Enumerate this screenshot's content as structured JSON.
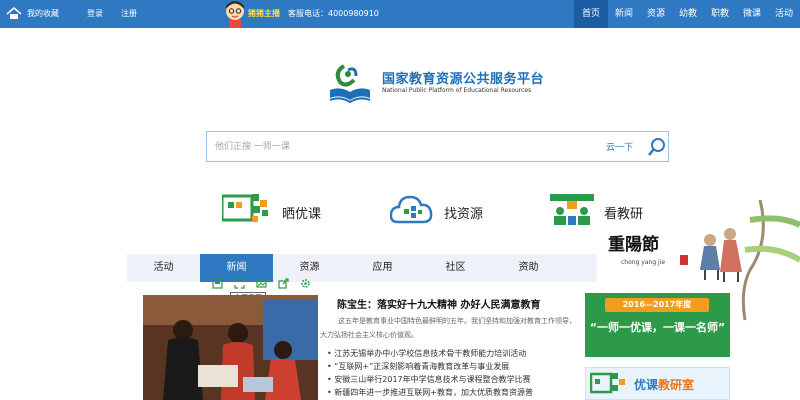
{
  "topbar": {
    "favorites": "我的收藏",
    "login": "登录",
    "register": "注册",
    "mascot_text": "猪猪主播",
    "hotline": "客服电话：4000980910",
    "nav": [
      "首页",
      "新闻",
      "资源",
      "幼教",
      "职教",
      "微课",
      "活动"
    ],
    "active_nav": "首页"
  },
  "logo": {
    "cn": "国家教育资源公共服务平台",
    "en": "National Public Platform of Educational Resources"
  },
  "search": {
    "placeholder": "他们正搜 一师一课",
    "button": "云一下"
  },
  "features": {
    "showcase": "晒优课",
    "find": "找资源",
    "research": "看教研"
  },
  "festival": {
    "title": "重陽節",
    "pinyin": "chong yang jie"
  },
  "tabs": [
    "活动",
    "新闻",
    "资源",
    "应用",
    "社区",
    "资助"
  ],
  "active_tab": "新闻",
  "toolbar_tooltip": "全屏看图",
  "article": {
    "headline": "陈宝生：落实好十九大精神  办好人民满意教育",
    "summary": "这五年是教育事业中国特色最鲜明的五年。我们坚持和加强对教育工作领导，大力弘扬社会主义核心价值观。",
    "news": [
      "江苏无锡举办中小学校信息技术骨干教师能力培训活动",
      "“互联网+”正深刻影响着青海教育改革与事业发展",
      "安徽三山举行2017年中学信息技术与课程整合教学比赛",
      "新疆四年进一步推进互联网+教育，加大优质教育资源普"
    ]
  },
  "banners": {
    "year": "2016—2017年度",
    "slogan": "“一师一优课，一课一名师”",
    "room_a": "优课",
    "room_b": "教研室"
  },
  "colors": {
    "brand_blue": "#2f79c2",
    "banner_green": "#2c9a48",
    "accent_orange": "#f19d1d"
  }
}
